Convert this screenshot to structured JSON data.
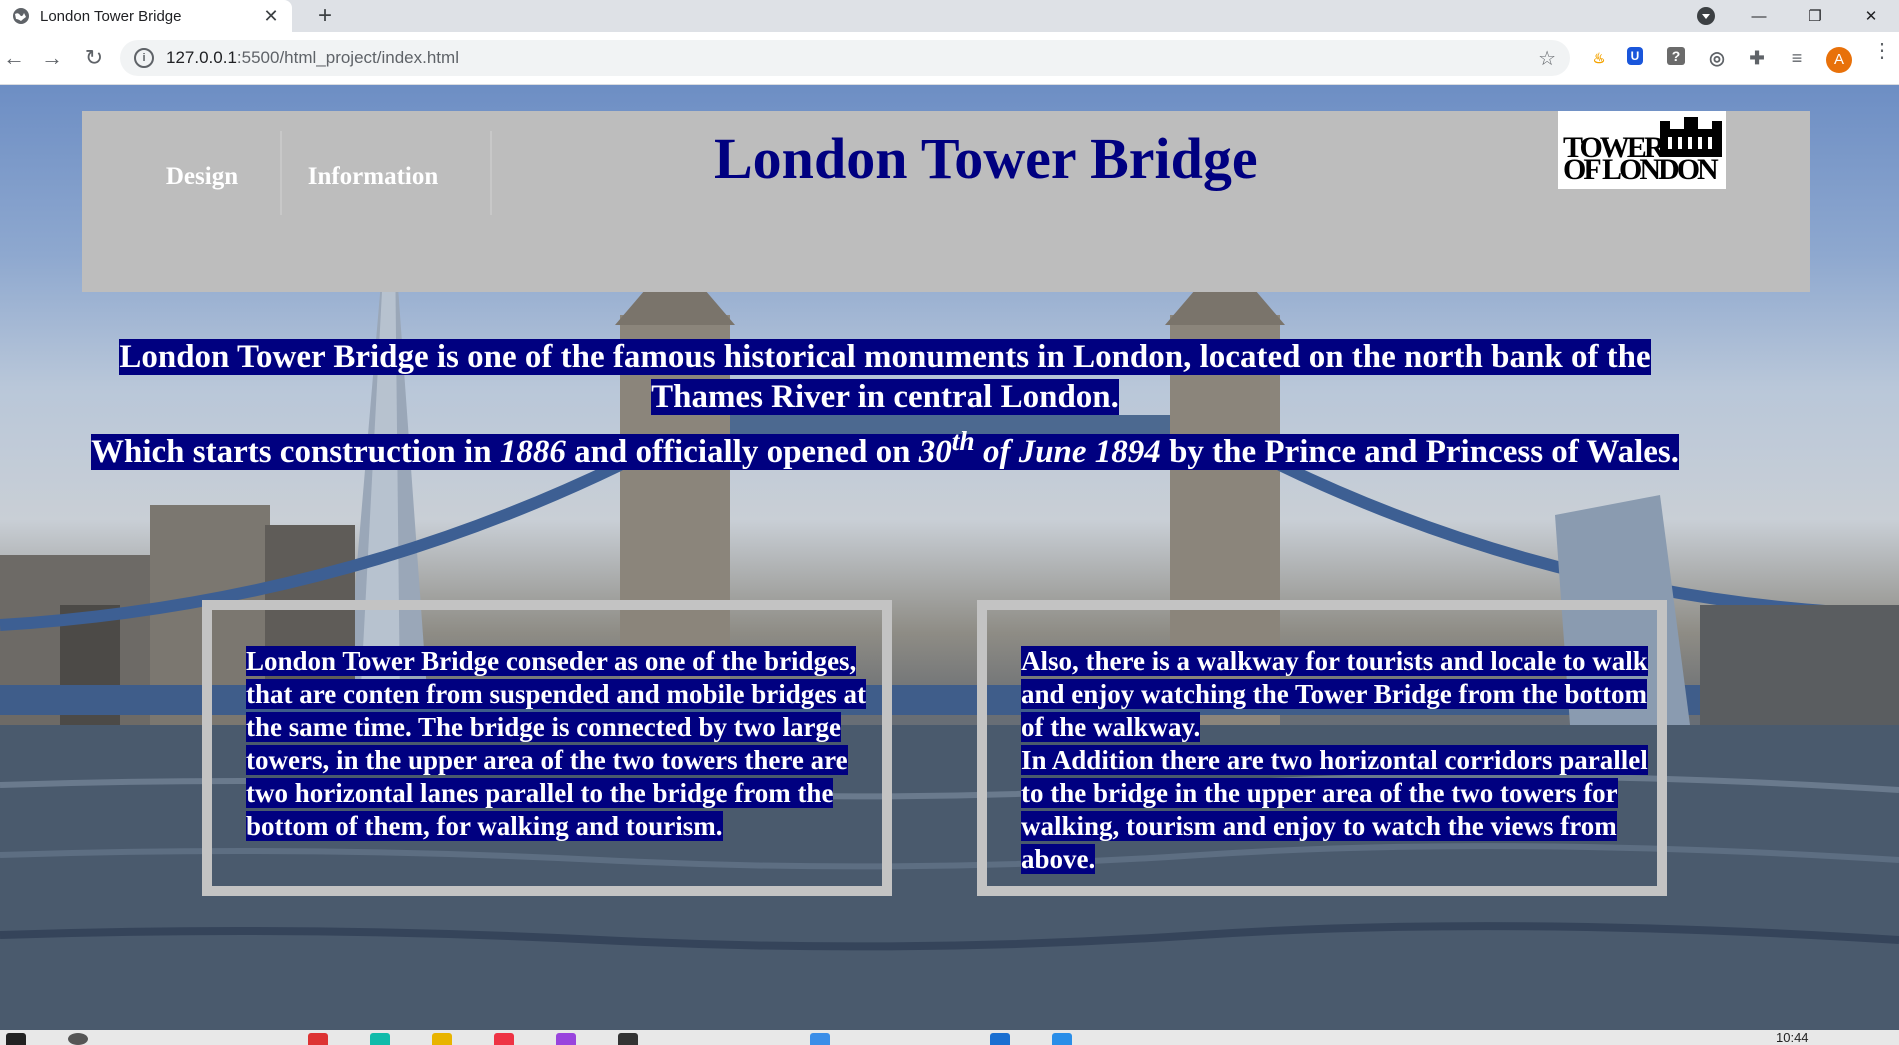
{
  "browser": {
    "tab_title": "London Tower Bridge",
    "url_host": "127.0.0.1",
    "url_rest": ":5500/html_project/index.html",
    "avatar_letter": "A",
    "accent": "#e8710a"
  },
  "header": {
    "nav": [
      {
        "label": "Design"
      },
      {
        "label": "Information"
      }
    ],
    "title": "London Tower Bridge",
    "logo_text_top": "TOWER",
    "logo_text_bottom": "OF LONDON",
    "background": "#bdbdbd",
    "title_color": "#000080"
  },
  "intro": {
    "line1": "London Tower Bridge is one of the famous historical monuments in London, located on the north bank of the Thames River in central London.",
    "line2_a": "Which starts construction in ",
    "line2_year": "1886",
    "line2_b": " and officially opened on ",
    "line2_day": "30",
    "line2_sup": "th",
    "line2_date": " of June 1894",
    "line2_c": " by the Prince and Princess of Wales.",
    "highlight": "#000080"
  },
  "boxes": {
    "left": "London Tower Bridge conseder as one of the bridges, that are conten from suspended and mobile bridges at the same time. The bridge is connected by two large towers, in the upper area of the two towers there are two horizontal lanes parallel to the bridge from the bottom of them, for walking and tourism.",
    "right_1": "Also, there is a walkway for tourists and locale to walk and enjoy watching the Tower Bridge from the bottom of the walkway.",
    "right_2": "In Addition there are two horizontal corridors parallel to the bridge in the upper area of the two towers for walking, tourism and enjoy to watch the views from above."
  },
  "taskbar": {
    "time": "10:44"
  }
}
